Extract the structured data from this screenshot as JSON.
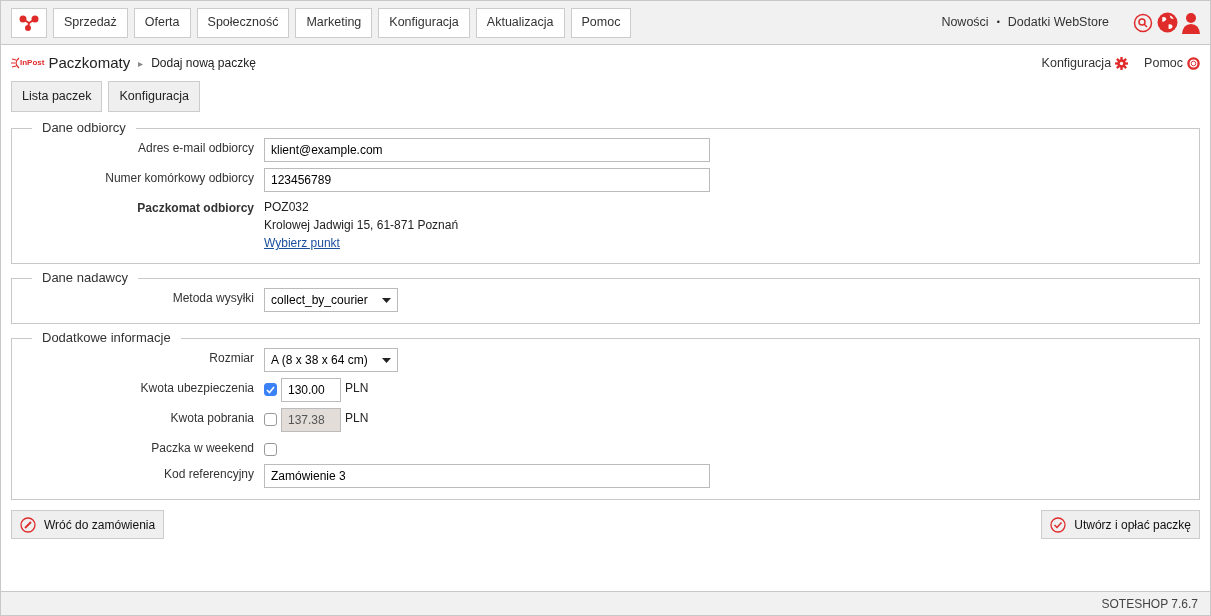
{
  "top_nav": {
    "items": [
      {
        "label": "Sprzedaż"
      },
      {
        "label": "Oferta"
      },
      {
        "label": "Społeczność"
      },
      {
        "label": "Marketing"
      },
      {
        "label": "Konfiguracja"
      },
      {
        "label": "Aktualizacja"
      },
      {
        "label": "Pomoc"
      }
    ],
    "links": [
      {
        "label": "Nowości"
      },
      {
        "label": "Dodatki WebStore"
      }
    ],
    "separator": "•"
  },
  "breadcrumb": {
    "logo_text": "InPost",
    "module": "Paczkomaty",
    "separator": "▸",
    "page": "Dodaj nową paczkę"
  },
  "header_links": [
    {
      "label": "Konfiguracja",
      "kind": "config"
    },
    {
      "label": "Pomoc",
      "kind": "help"
    }
  ],
  "subtabs": [
    {
      "label": "Lista paczek"
    },
    {
      "label": "Konfiguracja"
    }
  ],
  "sections": [
    {
      "title": "Dane odbiorcy",
      "fields": [
        {
          "kind": "text",
          "label": "Adres e-mail odbiorcy",
          "value": "klient@example.com"
        },
        {
          "kind": "text",
          "label": "Numer komórkowy odbiorcy",
          "value": "123456789"
        },
        {
          "kind": "info",
          "label": "Paczkomat odbiorcy",
          "lines": [
            "POZ032",
            "Krolowej Jadwigi 15, 61-871 Poznań"
          ],
          "link": "Wybierz punkt"
        }
      ]
    },
    {
      "title": "Dane nadawcy",
      "fields": [
        {
          "kind": "select",
          "label": "Metoda wysyłki",
          "value": "collect_by_courier"
        }
      ]
    },
    {
      "title": "Dodatkowe informacje",
      "fields": [
        {
          "kind": "select",
          "label": "Rozmiar",
          "value": "A (8 x 38 x 64 cm)"
        },
        {
          "kind": "amount",
          "label": "Kwota ubezpieczenia",
          "checked": true,
          "value": "130.00",
          "unit": "PLN"
        },
        {
          "kind": "amount",
          "label": "Kwota pobrania",
          "checked": false,
          "value": "137.38",
          "unit": "PLN"
        },
        {
          "kind": "checkbox",
          "label": "Paczka w weekend",
          "checked": false
        },
        {
          "kind": "text",
          "label": "Kod referencyjny",
          "value": "Zamówienie 3"
        }
      ]
    }
  ],
  "actions": {
    "back": "Wróć do zamówienia",
    "submit": "Utwórz i opłać paczkę"
  },
  "status_bar": {
    "version": "SOTESHOP 7.6.7"
  }
}
